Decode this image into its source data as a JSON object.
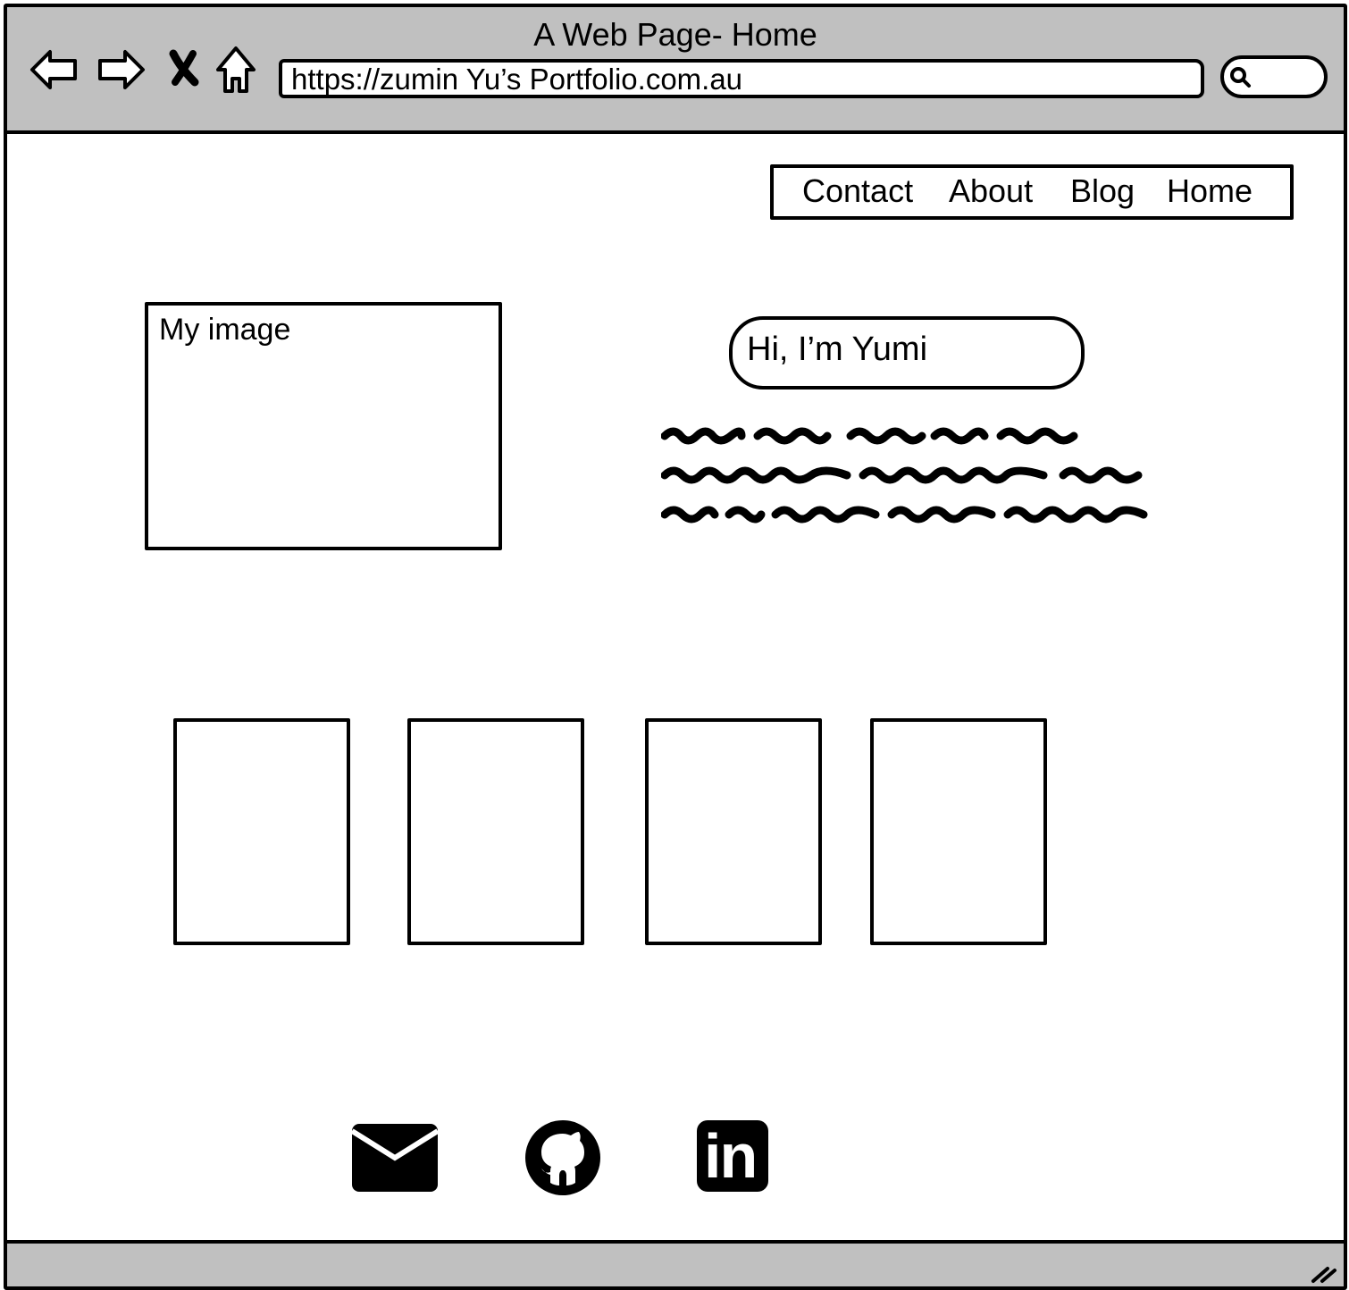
{
  "window": {
    "title": "A Web Page- Home"
  },
  "browser": {
    "url": "https://zumin Yu’s Portfolio.com.au",
    "nav_icons": [
      "back-arrow-icon",
      "forward-arrow-icon",
      "close-icon",
      "home-icon"
    ],
    "search_icon": "search-icon"
  },
  "menu": {
    "items": [
      {
        "label": "Contact"
      },
      {
        "label": "About"
      },
      {
        "label": "Blog"
      },
      {
        "label": "Home"
      }
    ]
  },
  "hero": {
    "image_label": "My image",
    "greeting": "Hi, I’m Yumi"
  },
  "social": {
    "icons": [
      "mail-icon",
      "github-icon",
      "linkedin-icon"
    ],
    "linkedin_text": "in"
  },
  "colors": {
    "chrome": "#c0c0c0",
    "ink": "#000000",
    "page": "#ffffff"
  }
}
